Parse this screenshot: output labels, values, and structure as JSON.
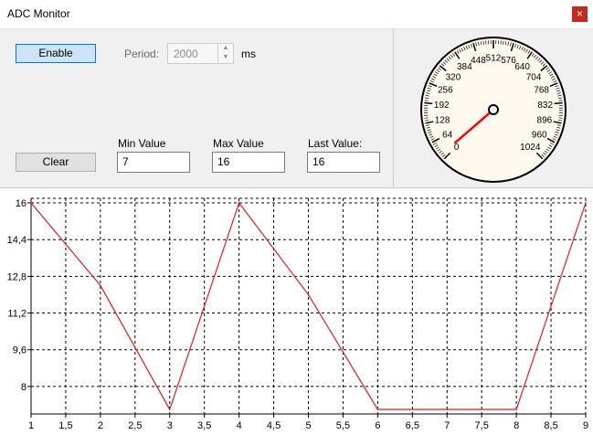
{
  "window": {
    "title": "ADC Monitor",
    "close_glyph": "×"
  },
  "controls": {
    "enable_label": "Enable",
    "clear_label": "Clear",
    "period_label": "Period:",
    "period_value": "2000",
    "period_unit": "ms",
    "min_label": "Min Value",
    "min_value": "7",
    "max_label": "Max Value",
    "max_value": "16",
    "last_label": "Last Value:",
    "last_value": "16"
  },
  "gauge": {
    "ticks": [
      "0",
      "64",
      "128",
      "192",
      "256",
      "320",
      "384",
      "448",
      "512",
      "576",
      "640",
      "704",
      "768",
      "832",
      "896",
      "960",
      "1024"
    ],
    "min": 0,
    "max": 1024,
    "value": 16,
    "needle_color": "#ff0000"
  },
  "chart_data": {
    "type": "line",
    "x": [
      1,
      2,
      3,
      4,
      5,
      6,
      7,
      8,
      9
    ],
    "series": [
      {
        "values": [
          16,
          12.4,
          7,
          16,
          12,
          7,
          7,
          7,
          16
        ],
        "color": "#e31b1b"
      }
    ],
    "xticks": [
      "1",
      "1,5",
      "2",
      "2,5",
      "3",
      "3,5",
      "4",
      "4,5",
      "5",
      "5,5",
      "6",
      "6,5",
      "7",
      "7,5",
      "8",
      "8,5",
      "9"
    ],
    "yticks": [
      "8",
      "9,6",
      "11,2",
      "12,8",
      "14,4",
      "16"
    ],
    "xlim": [
      1,
      9
    ],
    "ylim": [
      6.8,
      16.2
    ],
    "grid": true
  }
}
